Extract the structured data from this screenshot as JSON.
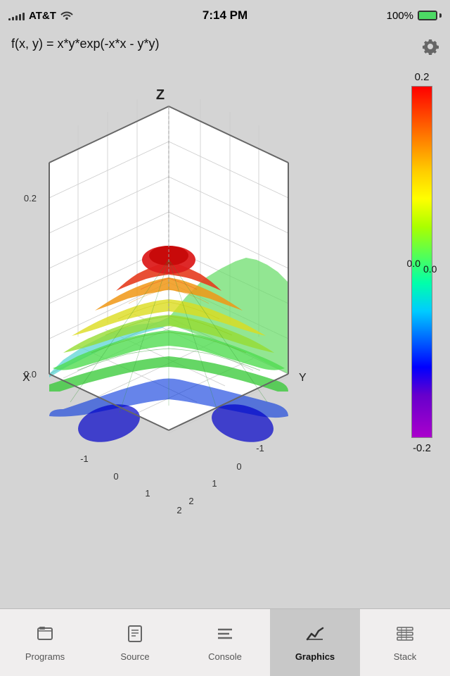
{
  "status_bar": {
    "carrier": "AT&T",
    "time": "7:14 PM",
    "battery": "100%",
    "signal_bars": [
      3,
      5,
      7,
      9,
      11
    ],
    "wifi": "wifi"
  },
  "header": {
    "formula": "f(x, y) = x*y*exp(-x*x - y*y)"
  },
  "colorbar": {
    "label_top": "0.2",
    "label_mid": "0.0",
    "label_bottom": "-0.2"
  },
  "plot": {
    "axis_x": "X",
    "axis_y": "Y",
    "axis_z": "Z",
    "x_ticks": [
      "-1",
      "0",
      "1",
      "2"
    ],
    "y_ticks": [
      "-1",
      "0",
      "1",
      "2"
    ],
    "z_ticks": [
      "0.2",
      "0.0"
    ]
  },
  "tabs": [
    {
      "id": "programs",
      "label": "Programs",
      "icon": "folder",
      "active": false
    },
    {
      "id": "source",
      "label": "Source",
      "icon": "doc",
      "active": false
    },
    {
      "id": "console",
      "label": "Console",
      "icon": "lines",
      "active": false
    },
    {
      "id": "graphics",
      "label": "Graphics",
      "icon": "chart",
      "active": true
    },
    {
      "id": "stack",
      "label": "Stack",
      "icon": "table",
      "active": false
    }
  ]
}
